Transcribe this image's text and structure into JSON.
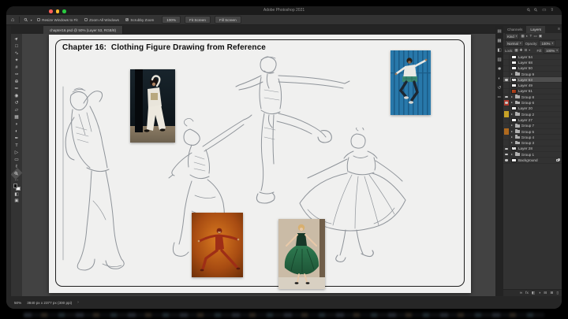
{
  "window": {
    "title": "Adobe Photoshop 2021",
    "icons": [
      {
        "id": "search-icon",
        "glyph": "⚲"
      },
      {
        "id": "zoom-icon",
        "glyph": "⚲"
      },
      {
        "id": "workspace-icon",
        "glyph": "▭"
      },
      {
        "id": "share-icon",
        "glyph": "⇧"
      }
    ]
  },
  "icons": {
    "home": "⌂",
    "zoom_tool": "⚲",
    "caret_down": "▾",
    "caret_right": "▸",
    "menu": "≡",
    "more": "›",
    "check": "✓"
  },
  "tool_options": {
    "checkboxes": [
      {
        "label": "Resize Windows to Fit",
        "checked": false
      },
      {
        "label": "Zoom All Windows",
        "checked": false
      },
      {
        "label": "Scrubby Zoom",
        "checked": true
      }
    ],
    "buttons": [
      "100%",
      "Fit Screen",
      "Fill Screen"
    ]
  },
  "document_tab": {
    "label": "chapter16.psd @ 50% (Layer 53, RGB/8)"
  },
  "toolbar": {
    "tools": [
      {
        "id": "move-tool",
        "glyph": "➤",
        "rot": -45
      },
      {
        "id": "marquee-tool",
        "glyph": "□"
      },
      {
        "id": "lasso-tool",
        "glyph": "∿"
      },
      {
        "id": "quick-selection-tool",
        "glyph": "✦"
      },
      {
        "id": "crop-tool",
        "glyph": "#"
      },
      {
        "id": "eyedropper-tool",
        "glyph": "✑"
      },
      {
        "id": "healing-brush-tool",
        "glyph": "⊕"
      },
      {
        "id": "brush-tool",
        "glyph": "✏"
      },
      {
        "id": "clone-stamp-tool",
        "glyph": "◉"
      },
      {
        "id": "history-brush-tool",
        "glyph": "↺"
      },
      {
        "id": "eraser-tool",
        "glyph": "▱"
      },
      {
        "id": "gradient-tool",
        "glyph": "▦"
      },
      {
        "id": "blur-tool",
        "glyph": "◗"
      },
      {
        "id": "dodge-tool",
        "glyph": "◐"
      },
      {
        "id": "pen-tool",
        "glyph": "✒"
      },
      {
        "id": "type-tool",
        "glyph": "T"
      },
      {
        "id": "path-selection-tool",
        "glyph": "▷"
      },
      {
        "id": "shape-tool",
        "glyph": "▭"
      },
      {
        "id": "hand-tool",
        "glyph": "✌"
      },
      {
        "id": "zoom-tool",
        "glyph": "⚲",
        "selected": true,
        "rot": -45
      }
    ]
  },
  "canvas": {
    "title": "Chapter 16:  Clothing Figure Drawing from Reference",
    "photos": [
      {
        "id": "photo-model-white-suit",
        "description": "model in white suit leaning on dark pole"
      },
      {
        "id": "photo-dancer-blue-wall",
        "description": "dancer jumping in front of blue corrugated wall"
      },
      {
        "id": "photo-dancer-orange",
        "description": "dancer in rust red outfit lunging on orange background"
      },
      {
        "id": "photo-green-dress",
        "description": "woman holding out green dress against beige wall"
      }
    ],
    "sketches": [
      {
        "id": "sketch-leaning-figure"
      },
      {
        "id": "sketch-lunging-figure"
      },
      {
        "id": "sketch-jumping-figure"
      },
      {
        "id": "sketch-skirt-figure"
      }
    ]
  },
  "panels": {
    "strip_icons": [
      {
        "id": "color-panel-icon",
        "glyph": "▤"
      },
      {
        "id": "swatches-panel-icon",
        "glyph": "▦"
      },
      {
        "id": "gradients-panel-icon",
        "glyph": "◧"
      },
      {
        "id": "patterns-panel-icon",
        "glyph": "▨"
      },
      {
        "id": "properties-panel-icon",
        "glyph": "✱"
      },
      {
        "id": "adjustments-panel-icon",
        "glyph": "◐"
      },
      {
        "id": "history-panel-icon",
        "glyph": "↺"
      },
      {
        "id": "brushes-panel-icon",
        "glyph": "✏"
      }
    ]
  },
  "layers_panel": {
    "tabs": [
      {
        "label": "Channels",
        "active": false
      },
      {
        "label": "Layers",
        "active": true
      }
    ],
    "filter_label": "Kind",
    "filter_icons": [
      {
        "id": "filter-pixel-icon",
        "glyph": "▦"
      },
      {
        "id": "filter-adjustment-icon",
        "glyph": "◐"
      },
      {
        "id": "filter-type-icon",
        "glyph": "T"
      },
      {
        "id": "filter-shape-icon",
        "glyph": "▭"
      },
      {
        "id": "filter-smart-icon",
        "glyph": "▣"
      }
    ],
    "blend_mode": "Normal",
    "opacity_label": "Opacity:",
    "opacity_value": "100%",
    "lock_label": "Lock:",
    "lock_icons": [
      {
        "id": "lock-transparency-icon",
        "glyph": "▦"
      },
      {
        "id": "lock-pixels-icon",
        "glyph": "✚"
      },
      {
        "id": "lock-position-icon",
        "glyph": "⊡"
      },
      {
        "id": "lock-all-icon",
        "glyph": "▪"
      }
    ],
    "fill_label": "Fill:",
    "fill_value": "100%",
    "layers": [
      {
        "name": "Layer 54",
        "kind": "layer",
        "thumb": "white",
        "eye": false
      },
      {
        "name": "Layer 68",
        "kind": "layer",
        "thumb": "white",
        "eye": false
      },
      {
        "name": "Layer 50",
        "kind": "layer",
        "thumb": "white",
        "eye": false
      },
      {
        "name": "Group 9",
        "kind": "group",
        "eye": false
      },
      {
        "name": "Layer 53",
        "kind": "layer",
        "thumb": "checker",
        "eye": true,
        "selected": true
      },
      {
        "name": "Layer 49",
        "kind": "layer",
        "thumb": "white",
        "eye": false
      },
      {
        "name": "Layer 51",
        "kind": "layer",
        "thumb": "red",
        "eye": false
      },
      {
        "name": "Group 8",
        "kind": "group",
        "eye": true
      },
      {
        "name": "Group 6",
        "kind": "group",
        "eye": true,
        "label": "#b03a2e"
      },
      {
        "name": "Layer 20",
        "kind": "layer",
        "thumb": "white",
        "eye": false
      },
      {
        "name": "Group 2",
        "kind": "group",
        "eye": false,
        "label": "#c8a227"
      },
      {
        "name": "Layer 27",
        "kind": "layer",
        "thumb": "white",
        "eye": false
      },
      {
        "name": "Group 7",
        "kind": "group",
        "eye": false
      },
      {
        "name": "Group 5",
        "kind": "group",
        "eye": false,
        "label": "#b06a1e"
      },
      {
        "name": "Group 4",
        "kind": "group",
        "eye": false
      },
      {
        "name": "Group 3",
        "kind": "group",
        "eye": false
      },
      {
        "name": "Layer 28",
        "kind": "layer",
        "thumb": "checker",
        "eye": true
      },
      {
        "name": "Group 1",
        "kind": "group",
        "eye": true
      },
      {
        "name": "Background",
        "kind": "background",
        "thumb": "white",
        "eye": true,
        "locked": true
      }
    ],
    "bottom_icons": [
      {
        "id": "link-layers-icon",
        "glyph": "∞"
      },
      {
        "id": "layer-effects-icon",
        "glyph": "fx"
      },
      {
        "id": "layer-mask-icon",
        "glyph": "◧"
      },
      {
        "id": "adjustment-layer-icon",
        "glyph": "◑"
      },
      {
        "id": "new-group-icon",
        "glyph": "⊟"
      },
      {
        "id": "new-layer-icon",
        "glyph": "⊞"
      },
      {
        "id": "delete-layer-icon",
        "glyph": "▯"
      }
    ]
  },
  "status_bar": {
    "zoom": "50%",
    "info": "3840 px x 2377 px (300 ppi)"
  },
  "colors": {
    "traffic_red": "#ff5f57",
    "traffic_yellow": "#febc2e",
    "traffic_green": "#28c840",
    "canvas_surround": "#424242",
    "artboard": "#f0f0ef",
    "pencil": "#8f949a"
  }
}
